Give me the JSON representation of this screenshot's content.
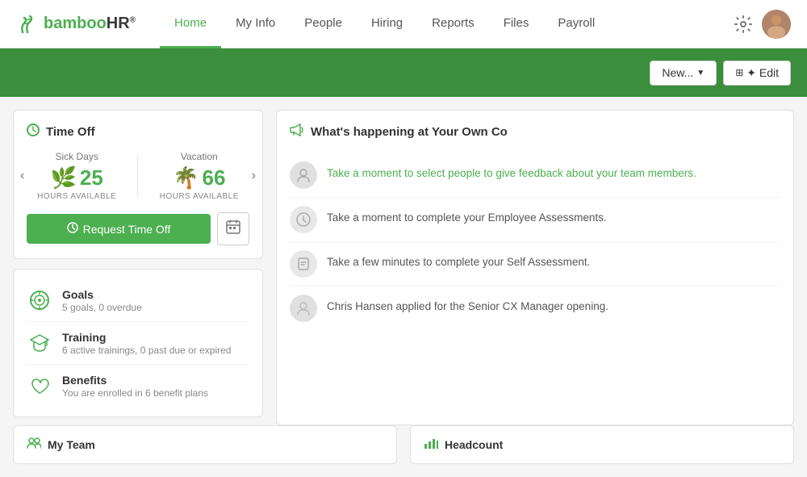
{
  "nav": {
    "logo": "bambooHR",
    "logo_reg": "®",
    "links": [
      {
        "id": "home",
        "label": "Home",
        "active": true
      },
      {
        "id": "myinfo",
        "label": "My Info",
        "active": false
      },
      {
        "id": "people",
        "label": "People",
        "active": false
      },
      {
        "id": "hiring",
        "label": "Hiring",
        "active": false
      },
      {
        "id": "reports",
        "label": "Reports",
        "active": false
      },
      {
        "id": "files",
        "label": "Files",
        "active": false
      },
      {
        "id": "payroll",
        "label": "Payroll",
        "active": false
      }
    ]
  },
  "toolbar": {
    "new_label": "New...",
    "edit_label": "✦ Edit"
  },
  "timeoff": {
    "title": "Time Off",
    "sick": {
      "label": "Sick Days",
      "value": "25",
      "sub": "HOURS AVAILABLE"
    },
    "vacation": {
      "label": "Vacation",
      "value": "66",
      "sub": "HOURS AVAILABLE"
    },
    "request_btn": "Request Time Off"
  },
  "info_items": [
    {
      "id": "goals",
      "icon": "🎯",
      "title": "Goals",
      "sub": "5 goals, 0 overdue"
    },
    {
      "id": "training",
      "icon": "🎓",
      "title": "Training",
      "sub": "6 active trainings, 0 past due or expired"
    },
    {
      "id": "benefits",
      "icon": "❤",
      "title": "Benefits",
      "sub": "You are enrolled in 6 benefit plans"
    }
  ],
  "news": {
    "title": "What's happening at Your Own Co",
    "items": [
      {
        "id": "feedback",
        "type": "link",
        "text": "Take a moment to select people to give feedback about your team members.",
        "icon": "person"
      },
      {
        "id": "assessment",
        "type": "text",
        "text": "Take a moment to complete your Employee Assessments.",
        "icon": "compass"
      },
      {
        "id": "self-assessment",
        "type": "text",
        "text": "Take a few minutes to complete your Self Assessment.",
        "icon": "award"
      },
      {
        "id": "application",
        "type": "text",
        "text": "Chris Hansen applied for the Senior CX Manager opening.",
        "icon": "person-gray"
      }
    ]
  },
  "bottom": {
    "team_icon": "👥",
    "team_label": "My Team",
    "headcount_icon": "📊",
    "headcount_label": "Headcount"
  }
}
